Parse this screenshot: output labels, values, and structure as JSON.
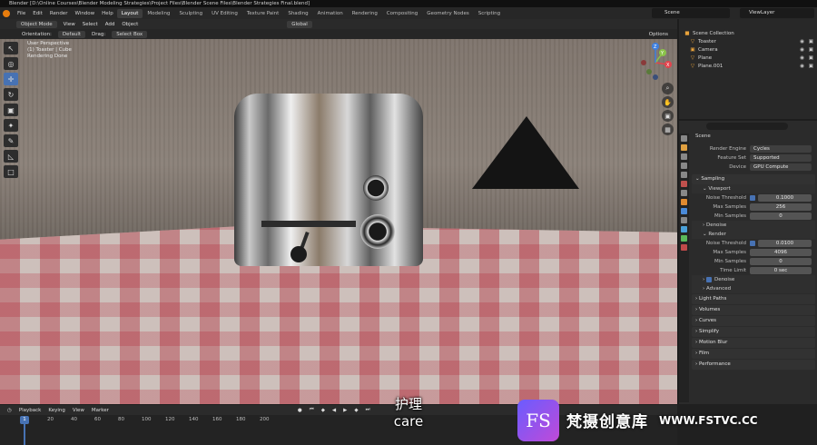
{
  "titlebar": {
    "text": "Blender [D:\\Online Courses\\Blender Modeling Strategies\\Project Files\\Blender Scene Files\\Blender Strategies Final.blend]"
  },
  "menubar": {
    "menus": [
      "File",
      "Edit",
      "Render",
      "Window",
      "Help"
    ],
    "workspaces": [
      "Layout",
      "Modeling",
      "Sculpting",
      "UV Editing",
      "Texture Paint",
      "Shading",
      "Animation",
      "Rendering",
      "Compositing",
      "Geometry Nodes",
      "Scripting"
    ],
    "active_workspace": "Layout",
    "scene": "Scene",
    "view_layer": "ViewLayer"
  },
  "viewport_header": {
    "mode": "Object Mode",
    "menus": [
      "View",
      "Select",
      "Add",
      "Object"
    ],
    "transform_orientation": "Global",
    "orientation_label": "Orientation:",
    "orientation_value": "Default",
    "drag_label": "Drag:",
    "drag_value": "Select Box",
    "options": "Options"
  },
  "viewport": {
    "info_line1": "User Perspective",
    "info_line2": "(1) Toaster | Cube",
    "info_line3": "Rendering Done",
    "gizmo": {
      "x": "X",
      "y": "Y",
      "z": "Z"
    }
  },
  "outliner": {
    "root": "Scene Collection",
    "items": [
      {
        "label": "Toaster",
        "icon": "triangle-icon"
      },
      {
        "label": "Camera",
        "icon": "camera-icon"
      },
      {
        "label": "Plane",
        "icon": "mesh-icon"
      },
      {
        "label": "Plane.001",
        "icon": "mesh-icon"
      }
    ]
  },
  "properties": {
    "context": "Scene",
    "render_engine_label": "Render Engine",
    "render_engine": "Cycles",
    "feature_set_label": "Feature Set",
    "feature_set": "Supported",
    "device_label": "Device",
    "device": "GPU Compute",
    "sampling": "Sampling",
    "viewport": "Viewport",
    "vp_noise_label": "Noise Threshold",
    "vp_noise": "0.1000",
    "vp_max_label": "Max Samples",
    "vp_max": "256",
    "vp_min_label": "Min Samples",
    "vp_min": "0",
    "vp_denoise": "Denoise",
    "render": "Render",
    "r_noise_label": "Noise Threshold",
    "r_noise": "0.0100",
    "r_max_label": "Max Samples",
    "r_max": "4096",
    "r_min_label": "Min Samples",
    "r_min": "0",
    "r_time_label": "Time Limit",
    "r_time": "0 sec",
    "r_denoise": "Denoise",
    "advanced": "Advanced",
    "panels": [
      "Light Paths",
      "Volumes",
      "Curves",
      "Simplify",
      "Motion Blur",
      "Film",
      "Performance"
    ]
  },
  "timeline": {
    "menus": [
      "Playback",
      "Keying",
      "View",
      "Marker"
    ],
    "current_frame": "1",
    "ticks": [
      "20",
      "40",
      "60",
      "80",
      "100",
      "120",
      "140",
      "160",
      "180",
      "200"
    ]
  },
  "subtitle": {
    "cn": "护理",
    "en": "care"
  },
  "watermark": {
    "logo": "FS",
    "cn": "梵摄创意库",
    "url": "WWW.FSTVC.CC"
  }
}
